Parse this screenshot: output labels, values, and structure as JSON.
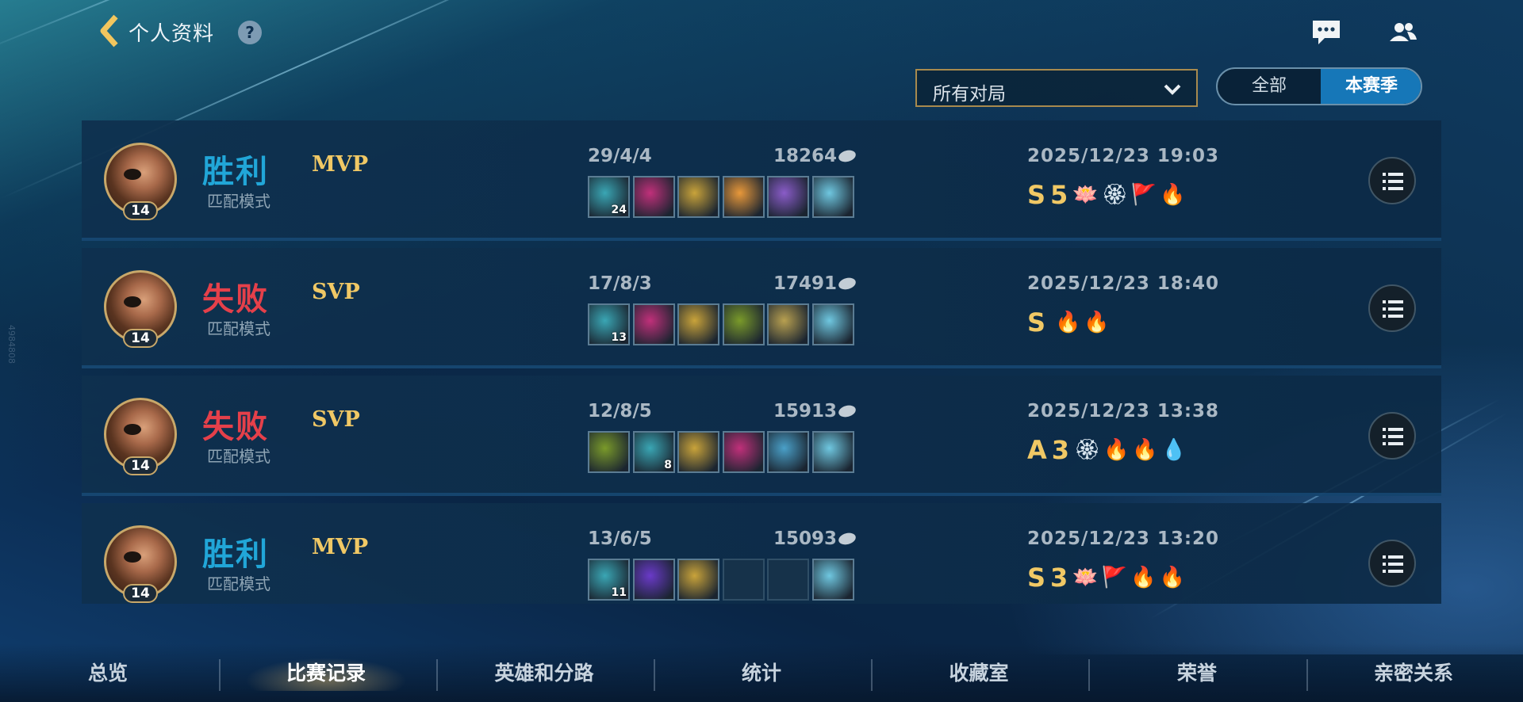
{
  "header": {
    "title": "个人资料",
    "help_label": "?",
    "back_icon": "chevron-left-icon",
    "chat_icon": "chat-icon",
    "friends_icon": "friends-icon"
  },
  "filters": {
    "match_type": "所有对局",
    "range_options": [
      "全部",
      "本赛季"
    ],
    "range_selected": "本赛季"
  },
  "matches": [
    {
      "result": "胜利",
      "result_type": "win",
      "mode": "匹配模式",
      "vp": "MVP",
      "level": "14",
      "kda": "29/4/4",
      "gold": "18264",
      "date": "2025/12/23 19:03",
      "items": [
        {
          "icon": "cannon-item-icon",
          "count": "24",
          "color": "#3aa6b4"
        },
        {
          "icon": "pink-blade-item-icon",
          "count": "",
          "color": "#c0307a"
        },
        {
          "icon": "lightning-blade-item-icon",
          "count": "",
          "color": "#c9a33a"
        },
        {
          "icon": "angel-item-icon",
          "count": "",
          "color": "#e8983a"
        },
        {
          "icon": "purple-cloak-item-icon",
          "count": "",
          "color": "#8a5cc8"
        },
        {
          "icon": "crystal-boots-item-icon",
          "count": "",
          "color": "#6fc7e0"
        }
      ],
      "grade": "S",
      "streak_mark": "5",
      "badges": [
        "🪷",
        "🏵",
        "🚩",
        "🔥"
      ]
    },
    {
      "result": "失败",
      "result_type": "lose",
      "mode": "匹配模式",
      "vp": "SVP",
      "level": "14",
      "kda": "17/8/3",
      "gold": "17491",
      "date": "2025/12/23 18:40",
      "items": [
        {
          "icon": "cannon-item-icon",
          "count": "13",
          "color": "#3aa6b4"
        },
        {
          "icon": "pink-blade-item-icon",
          "count": "",
          "color": "#c0307a"
        },
        {
          "icon": "lightning-blade-item-icon",
          "count": "",
          "color": "#c9a33a"
        },
        {
          "icon": "green-trident-item-icon",
          "count": "",
          "color": "#7a9a2a"
        },
        {
          "icon": "star-shield-item-icon",
          "count": "",
          "color": "#b8a050"
        },
        {
          "icon": "crystal-boots-item-icon",
          "count": "",
          "color": "#6fc7e0"
        }
      ],
      "grade": "S",
      "streak_mark": "",
      "badges": [
        "🔥",
        "🔥"
      ]
    },
    {
      "result": "失败",
      "result_type": "lose",
      "mode": "匹配模式",
      "vp": "SVP",
      "level": "14",
      "kda": "12/8/5",
      "gold": "15913",
      "date": "2025/12/23 13:38",
      "items": [
        {
          "icon": "green-trident-item-icon",
          "count": "",
          "color": "#7a9a2a"
        },
        {
          "icon": "cannon-item-icon",
          "count": "8",
          "color": "#3aa6b4"
        },
        {
          "icon": "lightning-blade-item-icon",
          "count": "",
          "color": "#c9a33a"
        },
        {
          "icon": "pink-blade-item-icon",
          "count": "",
          "color": "#c0307a"
        },
        {
          "icon": "blue-armor-item-icon",
          "count": "",
          "color": "#4aa0c8"
        },
        {
          "icon": "crystal-boots-item-icon",
          "count": "",
          "color": "#6fc7e0"
        }
      ],
      "grade": "A",
      "streak_mark": "3",
      "badges": [
        "🏵",
        "🔥",
        "🔥",
        "💧"
      ]
    },
    {
      "result": "胜利",
      "result_type": "win",
      "mode": "匹配模式",
      "vp": "MVP",
      "level": "14",
      "kda": "13/6/5",
      "gold": "15093",
      "date": "2025/12/23 13:20",
      "items": [
        {
          "icon": "cannon-item-icon",
          "count": "11",
          "color": "#3aa6b4"
        },
        {
          "icon": "purple-orb-item-icon",
          "count": "",
          "color": "#6a3ac8"
        },
        {
          "icon": "lightning-blade-item-icon",
          "count": "",
          "color": "#c9a33a"
        },
        {
          "icon": "empty-slot",
          "count": "",
          "color": ""
        },
        {
          "icon": "empty-slot",
          "count": "",
          "color": ""
        },
        {
          "icon": "crystal-boots-item-icon",
          "count": "",
          "color": "#6fc7e0"
        }
      ],
      "grade": "S",
      "streak_mark": "3",
      "badges": [
        "🪷",
        "🚩",
        "🔥",
        "🔥"
      ]
    }
  ],
  "nav": {
    "tabs": [
      "总览",
      "比赛记录",
      "英雄和分路",
      "统计",
      "收藏室",
      "荣誉",
      "亲密关系"
    ],
    "active": "比赛记录"
  },
  "colors": {
    "win": "#21a6d8",
    "lose": "#e5404a",
    "gold_accent": "#f0c865",
    "selected_segment": "#1677b8"
  },
  "watermark": "4984808"
}
